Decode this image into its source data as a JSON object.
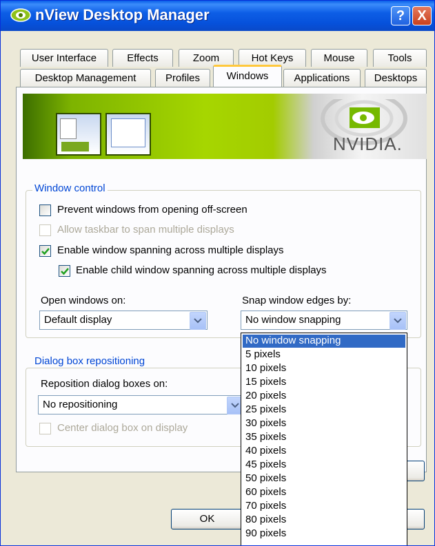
{
  "window": {
    "title": "nView Desktop Manager",
    "help_label": "?",
    "close_label": "X"
  },
  "tabs": {
    "row1": [
      "User Interface",
      "Effects",
      "Zoom",
      "Hot Keys",
      "Mouse",
      "Tools"
    ],
    "row2": [
      "Desktop Management",
      "Profiles",
      "Windows",
      "Applications",
      "Desktops"
    ],
    "active": "Windows"
  },
  "banner": {
    "brand": "NVIDIA."
  },
  "window_control": {
    "legend": "Window control",
    "prevent_offscreen": {
      "label": "Prevent windows from opening off-screen",
      "checked": false
    },
    "taskbar_span": {
      "label": "Allow taskbar to span multiple displays",
      "checked": false,
      "disabled": true
    },
    "window_spanning": {
      "label": "Enable window spanning across multiple displays",
      "checked": true
    },
    "child_spanning": {
      "label": "Enable child window spanning across multiple displays",
      "checked": true
    },
    "open_windows_label": "Open windows on:",
    "open_windows_value": "Default display",
    "snap_label": "Snap window edges by:",
    "snap_value": "No window snapping"
  },
  "snap_options": [
    "No window snapping",
    "5 pixels",
    "10 pixels",
    "15 pixels",
    "20 pixels",
    "25 pixels",
    "30 pixels",
    "35 pixels",
    "40 pixels",
    "45 pixels",
    "50 pixels",
    "60 pixels",
    "70 pixels",
    "80 pixels",
    "90 pixels"
  ],
  "dialog_repositioning": {
    "legend": "Dialog box repositioning",
    "reposition_label": "Reposition dialog boxes on:",
    "reposition_value": "No repositioning",
    "center_dialog": {
      "label": "Center dialog box on display",
      "checked": false,
      "disabled": true
    }
  },
  "buttons": {
    "ok": "OK"
  },
  "colors": {
    "titlebar": "#0a5fe8",
    "selection": "#316ac5",
    "group_legend": "#0046d5",
    "tab_highlight": "#ffc83c"
  }
}
